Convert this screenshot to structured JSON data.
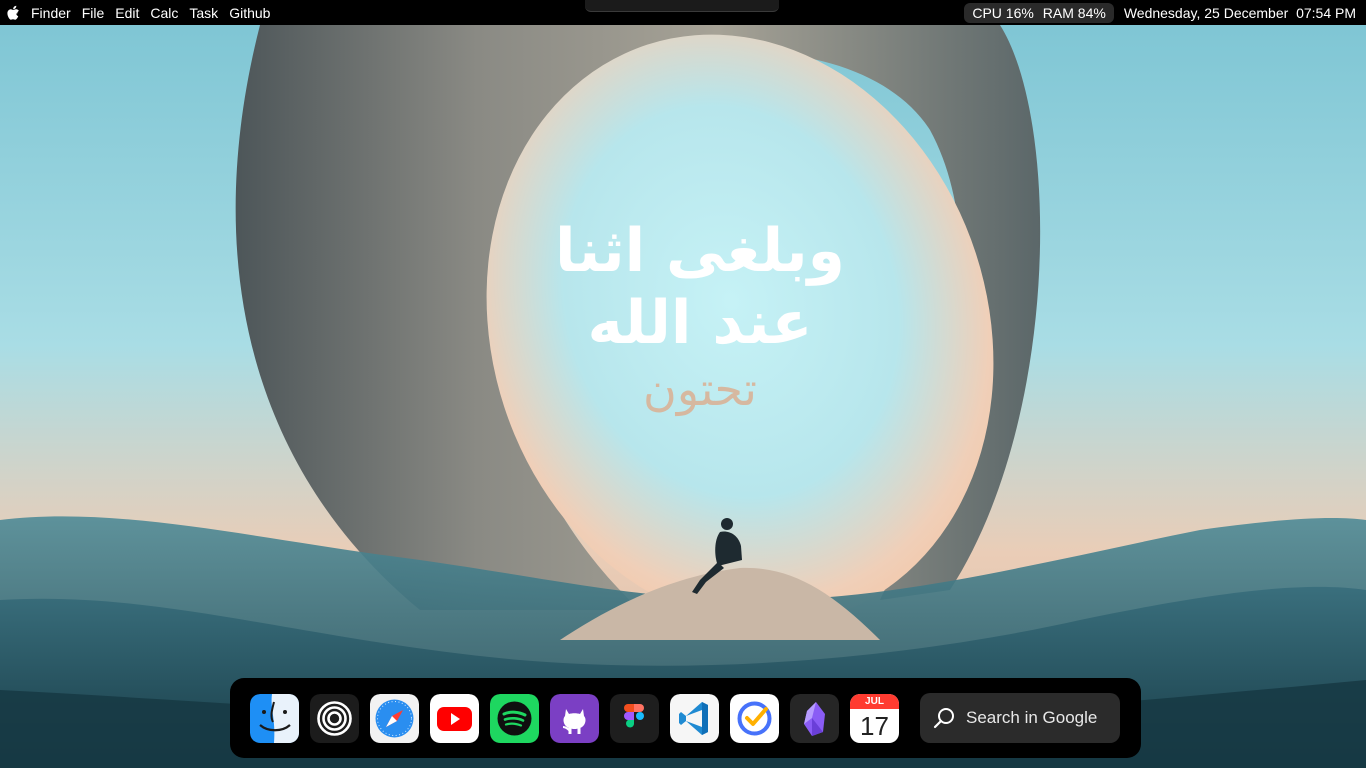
{
  "menubar": {
    "apple_icon": "apple-logo-icon",
    "items": [
      "Finder",
      "File",
      "Edit",
      "Calc",
      "Task",
      "Github"
    ],
    "cpu": "CPU 16%",
    "ram": "RAM 84%",
    "datetime": "Wednesday, 25 December  07:54 PM"
  },
  "wallpaper": {
    "calligraphy_line1": "وبلغى اثنا",
    "calligraphy_line2": "عند الله",
    "calligraphy_line3": "تحتون"
  },
  "dock": {
    "apps": [
      {
        "name": "Finder",
        "icon": "finder-icon"
      },
      {
        "name": "Rings",
        "icon": "rings-icon"
      },
      {
        "name": "Safari",
        "icon": "safari-icon"
      },
      {
        "name": "YouTube",
        "icon": "youtube-icon"
      },
      {
        "name": "Spotify",
        "icon": "spotify-icon"
      },
      {
        "name": "GitHub",
        "icon": "github-icon"
      },
      {
        "name": "Figma",
        "icon": "figma-icon"
      },
      {
        "name": "VS Code",
        "icon": "vscode-icon"
      },
      {
        "name": "TickTick",
        "icon": "ticktick-icon"
      },
      {
        "name": "Obsidian",
        "icon": "obsidian-icon"
      },
      {
        "name": "Calendar",
        "icon": "calendar-icon"
      }
    ],
    "calendar_month": "JUL",
    "calendar_day": "17",
    "search_placeholder": "Search in Google",
    "search_icon": "search-icon"
  },
  "colors": {
    "sky_top": "#8fd0dc",
    "sky_glow": "#f3c9a8",
    "arch": "#5f6b6f",
    "dune": "#2f5f6e",
    "menubar_bg": "#000000",
    "dock_bg": "#000000"
  }
}
